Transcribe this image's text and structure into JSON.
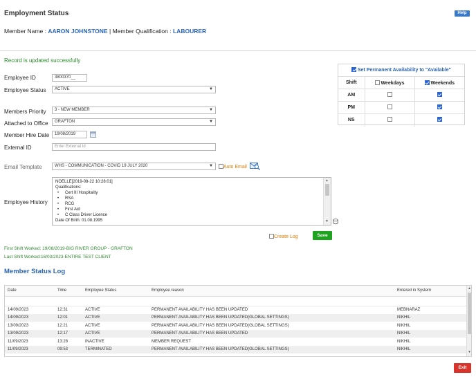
{
  "header": {
    "title": "Employment Status",
    "help_label": "Help",
    "member_name_label": "Member Name :",
    "member_name": "AARON JOHNSTONE",
    "separator": "|",
    "member_qualification_label": "Member Qualification :",
    "member_qualification": "LABOURER"
  },
  "status_message": "Record is updated successfully",
  "form": {
    "employee_id_label": "Employee ID",
    "employee_id_value": "3800370__",
    "employee_status_label": "Employee Status",
    "employee_status_value": "ACTIVE",
    "members_priority_label": "Members Priority",
    "members_priority_value": "3 - NEW MEMBER",
    "attached_office_label": "Attached to Office",
    "attached_office_value": "GRAFTON",
    "hire_date_label": "Member Hire Date",
    "hire_date_value": "19/08/2019",
    "external_id_label": "External ID",
    "external_id_placeholder": "Enter External Id",
    "email_template_label": "Email Template",
    "email_template_value": "WHS - COMMUNICATION - COVID 19 JULY 2020",
    "auto_email_label": "Auto Email",
    "employee_history_label": "Employee History",
    "history_lines": [
      "NOELLE[2019-08-22 10:28:01]",
      "Qualifications:",
      "Cert III Hospitality",
      "RSA",
      "RCG",
      "First Aid",
      "C Class Driver Licence",
      "Date Of Birth: 01.08.1995"
    ],
    "create_log_label": "Create Log",
    "save_label": "Save",
    "first_shift": "First Shift Worked: 19/08/2019-BIG RIVER GROUP - GRAFTON",
    "last_shift": "Last Shift Worked:16/03/2023-ENTIRE TEST CLIENT"
  },
  "availability": {
    "set_permanent_label": "Set Permanent Availability to \"Available\"",
    "set_permanent_checked": true,
    "col_shift": "Shift",
    "col_weekdays": "Weekdays",
    "col_weekends": "Weekends",
    "weekdays_checked": false,
    "weekends_checked": true,
    "rows": [
      {
        "shift": "AM",
        "weekdays": false,
        "weekends": true
      },
      {
        "shift": "PM",
        "weekdays": false,
        "weekends": true
      },
      {
        "shift": "NS",
        "weekdays": false,
        "weekends": true
      }
    ]
  },
  "log": {
    "title": "Member Status Log",
    "columns": [
      "Date",
      "Time",
      "Employee Status",
      "Employee reason",
      "Entered in System"
    ],
    "rows": [
      [
        "14/09/2023",
        "12:31",
        "ACTIVE",
        "PERMANENT AVAILABILITY HAS BEEN UPDATED",
        "MEBNARAZ"
      ],
      [
        "14/09/2023",
        "12:01",
        "ACTIVE",
        "PERMANENT AVAILABILITY HAS BEEN UPDATED(GLOBAL SETTINGS)",
        "NIKHIL"
      ],
      [
        "13/09/2023",
        "12:21",
        "ACTIVE",
        "PERMANENT AVAILABILITY HAS BEEN UPDATED(GLOBAL SETTINGS)",
        "NIKHIL"
      ],
      [
        "13/09/2023",
        "12:17",
        "ACTIVE",
        "PERMANENT AVAILABILITY HAS BEEN UPDATED",
        "NIKHIL"
      ],
      [
        "11/09/2023",
        "13:28",
        "INACTIVE",
        "MEMBER REQUEST",
        "NIKHIL"
      ],
      [
        "11/09/2023",
        "09:53",
        "TERMINATED",
        "PERMANENT AVAILABILITY HAS BEEN UPDATED(GLOBAL SETTINGS)",
        "NIKHIL"
      ]
    ]
  },
  "footer": {
    "exit_label": "Exit"
  },
  "colors": {
    "accent_blue": "#2b64b5",
    "success_green": "#2a8a2a",
    "save_green": "#1fa21f",
    "exit_red": "#d9342b",
    "auto_email_orange": "#e07b00"
  },
  "icons": {
    "calendar": "calendar-icon",
    "email_preview": "email-preview-icon",
    "history_clear": "history-clear-icon"
  }
}
